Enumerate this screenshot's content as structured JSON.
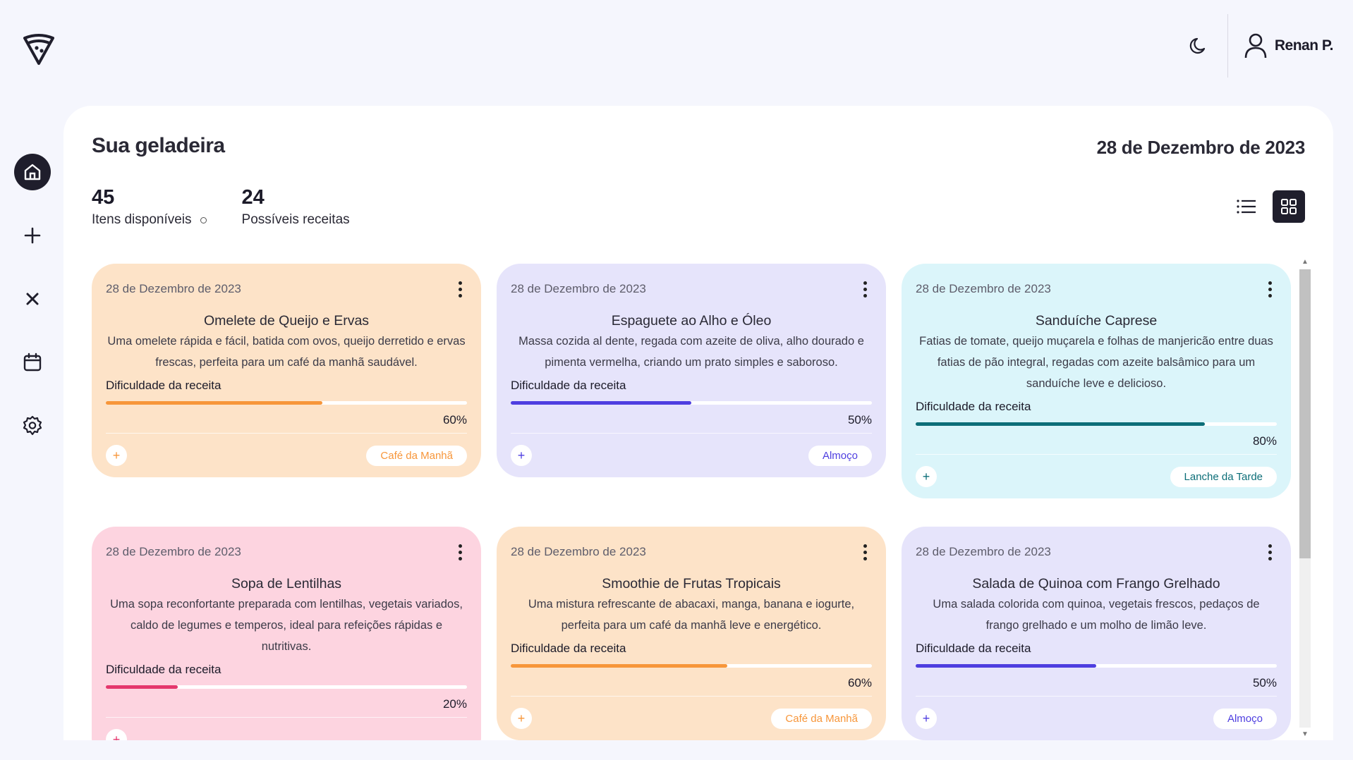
{
  "user": {
    "name": "Renan P."
  },
  "sidebar": {
    "items": [
      {
        "icon": "home-icon",
        "active": true
      },
      {
        "icon": "plus-icon",
        "active": false
      },
      {
        "icon": "close-icon",
        "active": false
      },
      {
        "icon": "calendar-icon",
        "active": false
      },
      {
        "icon": "gear-icon",
        "active": false
      }
    ]
  },
  "main": {
    "title": "Sua geladeira",
    "date": "28 de Dezembro de 2023",
    "stats": [
      {
        "value": "45",
        "label": "Itens disponíveis"
      },
      {
        "value": "24",
        "label": "Possíveis receitas"
      }
    ],
    "view_mode": "grid"
  },
  "colors": {
    "orange_bg": "#fde3c8",
    "orange_accent": "#f7963a",
    "purple_bg": "#e6e4fb",
    "purple_accent": "#4e3ee0",
    "cyan_bg": "#dbf5fa",
    "cyan_accent": "#0c6e78",
    "pink_bg": "#fdd4e0",
    "pink_accent": "#e5376d"
  },
  "cards": [
    {
      "date": "28 de Dezembro de 2023",
      "title": "Omelete de Queijo e Ervas",
      "description": "Uma omelete rápida e fácil, batida com ovos, queijo derretido e ervas frescas, perfeita para um café da manhã saudável.",
      "difficulty_label": "Dificuldade da receita",
      "difficulty": 60,
      "difficulty_text": "60%",
      "tag": "Café da Manhã",
      "add_label": "+"
    },
    {
      "date": "28 de Dezembro de 2023",
      "title": "Espaguete ao Alho e Óleo",
      "description": "Massa cozida al dente, regada com azeite de oliva, alho dourado e pimenta vermelha, criando um prato simples e saboroso.",
      "difficulty_label": "Dificuldade da receita",
      "difficulty": 50,
      "difficulty_text": "50%",
      "tag": "Almoço",
      "add_label": "+"
    },
    {
      "date": "28 de Dezembro de 2023",
      "title": "Sanduíche Caprese",
      "description": "Fatias de tomate, queijo muçarela e folhas de manjericão entre duas fatias de pão integral, regadas com azeite balsâmico para um sanduíche leve e delicioso.",
      "difficulty_label": "Dificuldade da receita",
      "difficulty": 80,
      "difficulty_text": "80%",
      "tag": "Lanche da Tarde",
      "add_label": "+"
    },
    {
      "date": "28 de Dezembro de 2023",
      "title": "Sopa de Lentilhas",
      "description": "Uma sopa reconfortante preparada com lentilhas, vegetais variados, caldo de legumes e temperos, ideal para refeições rápidas e nutritivas.",
      "difficulty_label": "Dificuldade da receita",
      "difficulty": 20,
      "difficulty_text": "20%",
      "tag": "",
      "add_label": "+"
    },
    {
      "date": "28 de Dezembro de 2023",
      "title": "Smoothie de Frutas Tropicais",
      "description": "Uma mistura refrescante de abacaxi, manga, banana e iogurte, perfeita para um café da manhã leve e energético.",
      "difficulty_label": "Dificuldade da receita",
      "difficulty": 60,
      "difficulty_text": "60%",
      "tag": "Café da Manhã",
      "add_label": "+"
    },
    {
      "date": "28 de Dezembro de 2023",
      "title": "Salada de Quinoa com Frango Grelhado",
      "description": "Uma salada colorida com quinoa, vegetais frescos, pedaços de frango grelhado e um molho de limão leve.",
      "difficulty_label": "Dificuldade da receita",
      "difficulty": 50,
      "difficulty_text": "50%",
      "tag": "Almoço",
      "add_label": "+"
    }
  ]
}
